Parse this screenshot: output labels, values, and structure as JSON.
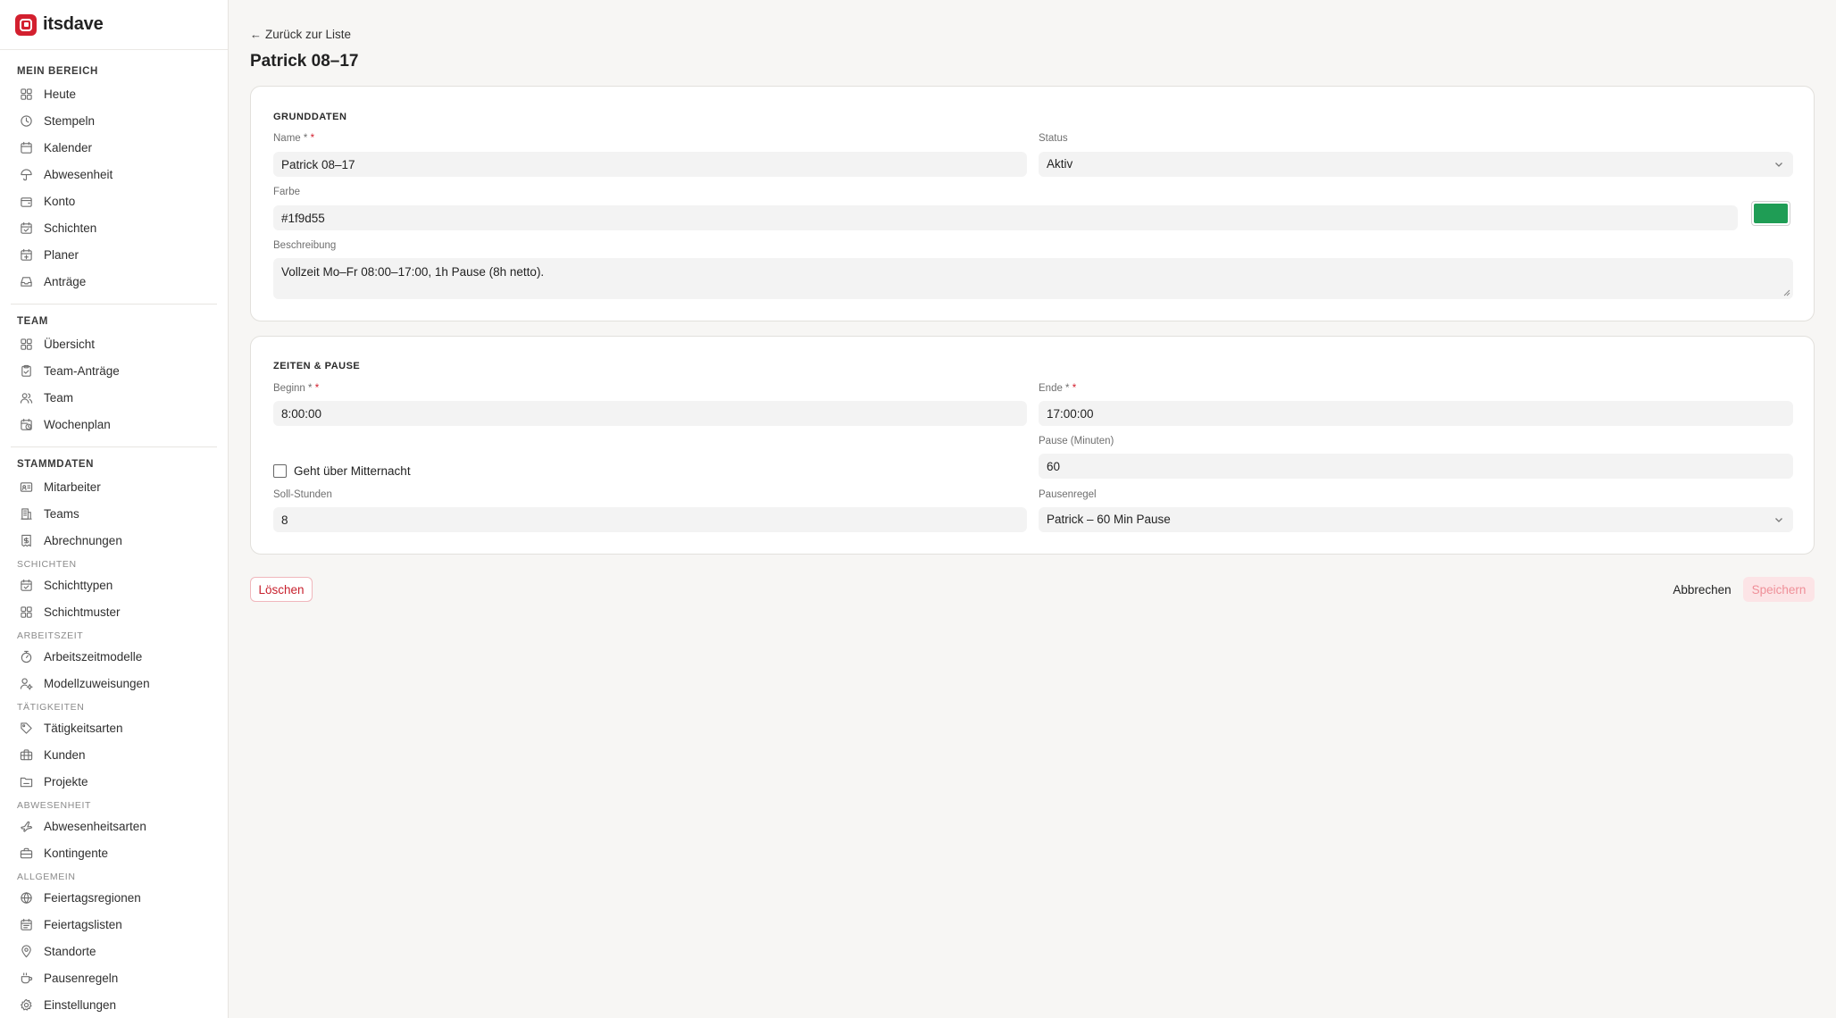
{
  "brand": {
    "name": "itsdave"
  },
  "sidebar": {
    "mein_bereich": {
      "title": "MEIN BEREICH",
      "items": [
        {
          "label": "Heute",
          "icon": "dashboard-icon"
        },
        {
          "label": "Stempeln",
          "icon": "clock-icon"
        },
        {
          "label": "Kalender",
          "icon": "calendar-icon"
        },
        {
          "label": "Abwesenheit",
          "icon": "umbrella-icon"
        },
        {
          "label": "Konto",
          "icon": "wallet-icon"
        },
        {
          "label": "Schichten",
          "icon": "calendar-check-icon"
        },
        {
          "label": "Planer",
          "icon": "calendar-plus-icon"
        },
        {
          "label": "Anträge",
          "icon": "inbox-icon"
        }
      ]
    },
    "team": {
      "title": "TEAM",
      "items": [
        {
          "label": "Übersicht",
          "icon": "dashboard-icon"
        },
        {
          "label": "Team-Anträge",
          "icon": "clipboard-check-icon"
        },
        {
          "label": "Team",
          "icon": "users-icon"
        },
        {
          "label": "Wochenplan",
          "icon": "calendar-clock-icon"
        }
      ]
    },
    "stammdaten": {
      "title": "STAMMDATEN",
      "items": [
        {
          "label": "Mitarbeiter",
          "icon": "id-card-icon"
        },
        {
          "label": "Teams",
          "icon": "building-icon"
        },
        {
          "label": "Abrechnungen",
          "icon": "receipt-icon"
        }
      ]
    },
    "schichten": {
      "title": "SCHICHTEN",
      "items": [
        {
          "label": "Schichttypen",
          "icon": "calendar-check-icon"
        },
        {
          "label": "Schichtmuster",
          "icon": "dashboard-icon"
        }
      ]
    },
    "arbeitszeit": {
      "title": "ARBEITSZEIT",
      "items": [
        {
          "label": "Arbeitszeitmodelle",
          "icon": "timer-icon"
        },
        {
          "label": "Modellzuweisungen",
          "icon": "user-cog-icon"
        }
      ]
    },
    "taetigkeiten": {
      "title": "TÄTIGKEITEN",
      "items": [
        {
          "label": "Tätigkeitsarten",
          "icon": "tag-icon"
        },
        {
          "label": "Kunden",
          "icon": "briefcase-icon"
        },
        {
          "label": "Projekte",
          "icon": "folder-icon"
        }
      ]
    },
    "abwesenheit": {
      "title": "ABWESENHEIT",
      "items": [
        {
          "label": "Abwesenheitsarten",
          "icon": "plane-icon"
        },
        {
          "label": "Kontingente",
          "icon": "suitcase-icon"
        }
      ]
    },
    "allgemein": {
      "title": "ALLGEMEIN",
      "items": [
        {
          "label": "Feiertagsregionen",
          "icon": "globe-icon"
        },
        {
          "label": "Feiertagslisten",
          "icon": "calendar-list-icon"
        },
        {
          "label": "Standorte",
          "icon": "map-pin-icon"
        },
        {
          "label": "Pausenregeln",
          "icon": "coffee-icon"
        },
        {
          "label": "Einstellungen",
          "icon": "gear-icon"
        }
      ]
    }
  },
  "header": {
    "back_label": "Zurück zur Liste",
    "title": "Patrick 08–17"
  },
  "grunddaten": {
    "title": "GRUNDDATEN",
    "name_label": "Name *",
    "name_value": "Patrick 08–17",
    "status_label": "Status",
    "status_value": "Aktiv",
    "farbe_label": "Farbe",
    "farbe_value": "#1f9d55",
    "beschreibung_label": "Beschreibung",
    "beschreibung_value": "Vollzeit Mo–Fr 08:00–17:00, 1h Pause (8h netto)."
  },
  "zeiten": {
    "title": "ZEITEN & PAUSE",
    "beginn_label": "Beginn *",
    "beginn_value": "8:00:00",
    "ende_label": "Ende *",
    "ende_value": "17:00:00",
    "pause_label": "Pause (Minuten)",
    "pause_value": "60",
    "mitternacht_label": "Geht über Mitternacht",
    "soll_label": "Soll-Stunden",
    "soll_value": "8",
    "pausenregel_label": "Pausenregel",
    "pausenregel_value": "Patrick – 60 Min Pause"
  },
  "actions": {
    "delete": "Löschen",
    "cancel": "Abbrechen",
    "save": "Speichern"
  },
  "colors": {
    "accent": "#d3202f",
    "swatch": "#1f9d55"
  }
}
